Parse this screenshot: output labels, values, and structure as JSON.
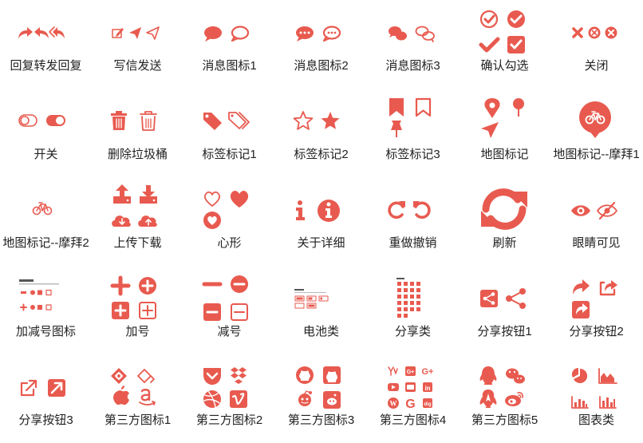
{
  "accent_color": "#e85a4f",
  "icon_sets": [
    {
      "label": "回复转发回复",
      "icons": [
        "reply-icon",
        "reply-all-icon",
        "forward-icon"
      ]
    },
    {
      "label": "写信发送",
      "icons": [
        "compose-icon",
        "send-filled-icon",
        "send-outline-icon"
      ]
    },
    {
      "label": "消息图标1",
      "icons": [
        "chat-bubble-filled-icon",
        "chat-bubble-outline-icon"
      ]
    },
    {
      "label": "消息图标2",
      "icons": [
        "chat-dots-filled-icon",
        "chat-dots-outline-icon"
      ]
    },
    {
      "label": "消息图标3",
      "icons": [
        "chats-filled-icon",
        "chats-outline-icon"
      ]
    },
    {
      "label": "确认勾选",
      "icons": [
        "check-circle-icon",
        "check-circle-filled-icon",
        "check-icon",
        "check-square-icon"
      ]
    },
    {
      "label": "关闭",
      "icons": [
        "close-icon",
        "close-circle-outline-icon",
        "close-circle-filled-icon"
      ]
    },
    {
      "label": "开关",
      "icons": [
        "toggle-off-icon",
        "toggle-on-icon"
      ]
    },
    {
      "label": "删除垃圾桶",
      "icons": [
        "trash-filled-icon",
        "trash-outline-icon"
      ]
    },
    {
      "label": "标签标记1",
      "icons": [
        "tag-icon",
        "tags-icon"
      ]
    },
    {
      "label": "标签标记2",
      "icons": [
        "star-outline-icon",
        "star-filled-icon"
      ]
    },
    {
      "label": "标签标记3",
      "icons": [
        "bookmark-filled-icon",
        "bookmark-outline-icon",
        "pushpin-icon"
      ]
    },
    {
      "label": "地图标记",
      "icons": [
        "map-marker-icon",
        "map-pin-icon",
        "location-arrow-icon"
      ]
    },
    {
      "label": "地图标记--摩拜1",
      "icons": [
        "bike-marker-icon"
      ]
    },
    {
      "label": "地图标记--摩拜2",
      "icons": [
        "bike-icon"
      ]
    },
    {
      "label": "上传下载",
      "icons": [
        "upload-tray-icon",
        "download-tray-icon",
        "cloud-download-icon",
        "cloud-upload-icon"
      ]
    },
    {
      "label": "心形",
      "icons": [
        "heart-outline-icon",
        "heart-filled-icon",
        "heart-circle-icon"
      ]
    },
    {
      "label": "关于详细",
      "icons": [
        "info-icon",
        "info-circle-icon"
      ]
    },
    {
      "label": "重做撤销",
      "icons": [
        "redo-icon",
        "undo-icon"
      ]
    },
    {
      "label": "刷新",
      "icons": [
        "refresh-icon"
      ]
    },
    {
      "label": "眼睛可见",
      "icons": [
        "eye-icon",
        "eye-slash-icon"
      ]
    },
    {
      "label": "加减号图标",
      "icons": [
        "plus-minus-thumbnail-icon"
      ]
    },
    {
      "label": "加号",
      "icons": [
        "plus-icon",
        "plus-circle-icon",
        "plus-square-filled-icon",
        "plus-square-outline-icon"
      ]
    },
    {
      "label": "减号",
      "icons": [
        "minus-icon",
        "minus-circle-icon",
        "minus-square-filled-icon",
        "minus-square-outline-icon"
      ]
    },
    {
      "label": "电池类",
      "icons": [
        "battery-thumbnail-icon"
      ]
    },
    {
      "label": "分享类",
      "icons": [
        "share-thumbnail-icon"
      ]
    },
    {
      "label": "分享按钮1",
      "icons": [
        "share-square-icon",
        "share-nodes-icon"
      ]
    },
    {
      "label": "分享按钮2",
      "icons": [
        "share-arrow-icon",
        "share-square-arrow-icon",
        "share-square-filled-icon"
      ]
    },
    {
      "label": "分享按钮3",
      "icons": [
        "external-link-icon",
        "external-link-square-icon"
      ]
    },
    {
      "label": "第三方图标1",
      "icons": [
        "gitlab-like-icon",
        "gitlab-like-outline-icon",
        "apple-icon",
        "amazon-icon"
      ]
    },
    {
      "label": "第三方图标2",
      "icons": [
        "pocket-icon",
        "dropbox-icon",
        "dribbble-icon",
        "vimeo-icon"
      ]
    },
    {
      "label": "第三方图标3",
      "icons": [
        "github-icon",
        "github-square-icon",
        "reddit-icon",
        "reddit-square-icon"
      ]
    },
    {
      "label": "第三方图标4",
      "icons": [
        "y-combinator-icon",
        "google-plus-square-icon",
        "google-plus-icon",
        "youtube-icon",
        "youtube-square-icon",
        "linkedin-icon",
        "wordpress-icon",
        "google-icon",
        "digg-icon"
      ]
    },
    {
      "label": "第三方图标5",
      "icons": [
        "qq-icon",
        "wechat-icon",
        "qq-outline-icon",
        "weibo-icon"
      ]
    },
    {
      "label": "图表类",
      "icons": [
        "pie-chart-icon",
        "area-chart-icon",
        "bar-chart-icon",
        "bar-chart-alt-icon"
      ]
    }
  ]
}
